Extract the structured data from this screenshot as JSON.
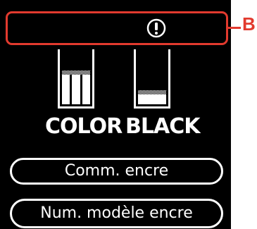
{
  "status_bar": {
    "alert_icon": "exclamation-circle-icon"
  },
  "callout": {
    "label": "B",
    "color": "#e23a2e"
  },
  "ink": [
    {
      "label": "COLOR",
      "level": 0.6,
      "cartridges": 3
    },
    {
      "label": "BLACK",
      "level": 0.25,
      "cartridges": 1
    }
  ],
  "buttons": {
    "order_ink": "Comm. encre",
    "ink_model": "Num. modèle encre"
  }
}
